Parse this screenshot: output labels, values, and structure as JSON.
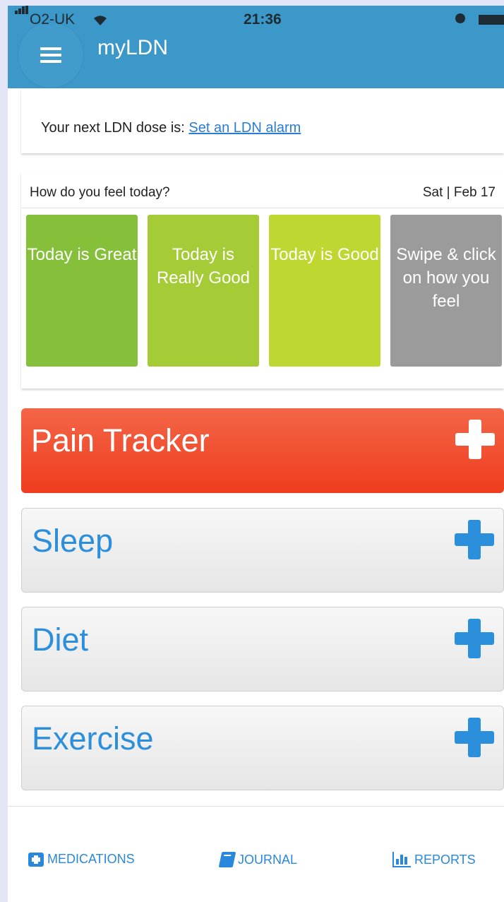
{
  "status_bar": {
    "carrier": "O2-UK",
    "time": "21:36"
  },
  "app": {
    "title": "myLDN"
  },
  "dose": {
    "text": "Your next LDN dose is: ",
    "link": "Set an LDN alarm"
  },
  "feel": {
    "question": "How do you feel today?",
    "date": "Sat | Feb 17",
    "moods": [
      {
        "label": "Today is Great",
        "color": "#86bf3a"
      },
      {
        "label": "Today is Really Good",
        "color": "#a5cc36"
      },
      {
        "label": "Today is Good",
        "color": "#c0d631"
      },
      {
        "label": "Swipe & click on how you feel",
        "color": "#9b9b9b"
      }
    ]
  },
  "trackers": {
    "pain": "Pain Tracker",
    "sleep": "Sleep",
    "diet": "Diet",
    "exercise": "Exercise"
  },
  "nav": {
    "medications": "MEDICATIONS",
    "journal": "JOURNAL",
    "reports": "REPORTS"
  },
  "colors": {
    "header": "#3b98c9",
    "accent": "#2b8fdc",
    "pain": "#f04a2a"
  }
}
